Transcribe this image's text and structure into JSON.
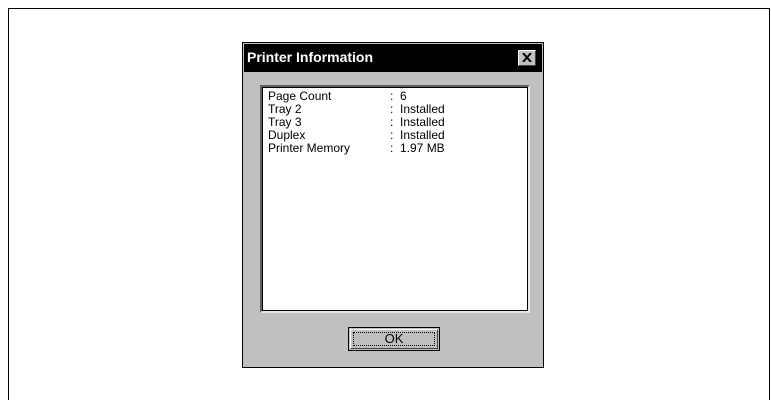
{
  "dialog": {
    "title": "Printer Information",
    "close_icon": "close-x-icon",
    "rows": [
      {
        "label": "Page Count",
        "sep": ":",
        "value": "6"
      },
      {
        "label": "Tray 2",
        "sep": ":",
        "value": "Installed"
      },
      {
        "label": "Tray 3",
        "sep": ":",
        "value": "Installed"
      },
      {
        "label": "Duplex",
        "sep": ":",
        "value": "Installed"
      },
      {
        "label": "Printer Memory",
        "sep": ":",
        "value": "1.97 MB"
      }
    ],
    "ok_label": "OK"
  },
  "colors": {
    "titlebar": "#000000",
    "dialog_face": "#c0c0c0",
    "list_background": "#ffffff"
  }
}
